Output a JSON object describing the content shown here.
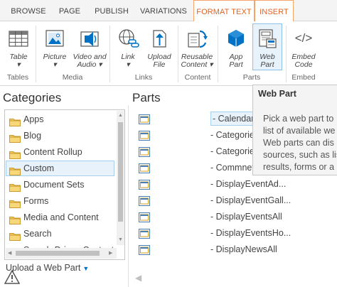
{
  "tabs": [
    "BROWSE",
    "PAGE",
    "PUBLISH",
    "VARIATIONS",
    "FORMAT TEXT",
    "INSERT"
  ],
  "ribbon": {
    "buttons": [
      {
        "label1": "Table",
        "label2": "",
        "icon": "table-icon"
      },
      {
        "label1": "Picture",
        "label2": "",
        "icon": "picture-icon"
      },
      {
        "label1": "Video and",
        "label2": "Audio",
        "icon": "video-audio-icon"
      },
      {
        "label1": "Link",
        "label2": "",
        "icon": "link-icon"
      },
      {
        "label1": "Upload",
        "label2": "File",
        "icon": "upload-file-icon"
      },
      {
        "label1": "Reusable",
        "label2": "Content",
        "icon": "reusable-content-icon"
      },
      {
        "label1": "App",
        "label2": "Part",
        "icon": "app-part-icon"
      },
      {
        "label1": "Web",
        "label2": "Part",
        "icon": "web-part-icon"
      },
      {
        "label1": "Embed",
        "label2": "Code",
        "icon": "embed-code-icon"
      }
    ],
    "groups": [
      "Tables",
      "Media",
      "Links",
      "Content",
      "Parts",
      "Embed"
    ],
    "dropdown_caret": "▾",
    "embed_glyph": "</>"
  },
  "categories": {
    "heading": "Categories",
    "items": [
      "Apps",
      "Blog",
      "Content Rollup",
      "Custom",
      "Document Sets",
      "Forms",
      "Media and Content",
      "Search",
      "Search-Driven Content"
    ],
    "selected": "Custom"
  },
  "upload_label": "Upload a Web Part",
  "parts": {
    "heading": "Parts",
    "items": [
      "- Calendar",
      "- Categories",
      "- Categories",
      "- Commnet",
      "- DisplayEventAd...",
      "- DisplayEventGall...",
      "- DisplayEventsAll",
      "- DisplayEventsHo...",
      "- DisplayNewsAll"
    ],
    "selected": "- Calendar"
  },
  "tooltip": {
    "title": "Web Part",
    "lines": [
      "Pick a web part to",
      "list of available we",
      "Web parts can dis",
      "sources, such as lis",
      "results, forms or a"
    ]
  },
  "colors": {
    "accent_orange": "#e16325",
    "selection_blue": "#e8f2fb",
    "selection_border": "#a6d0f1",
    "link_blue": "#0072c6"
  }
}
